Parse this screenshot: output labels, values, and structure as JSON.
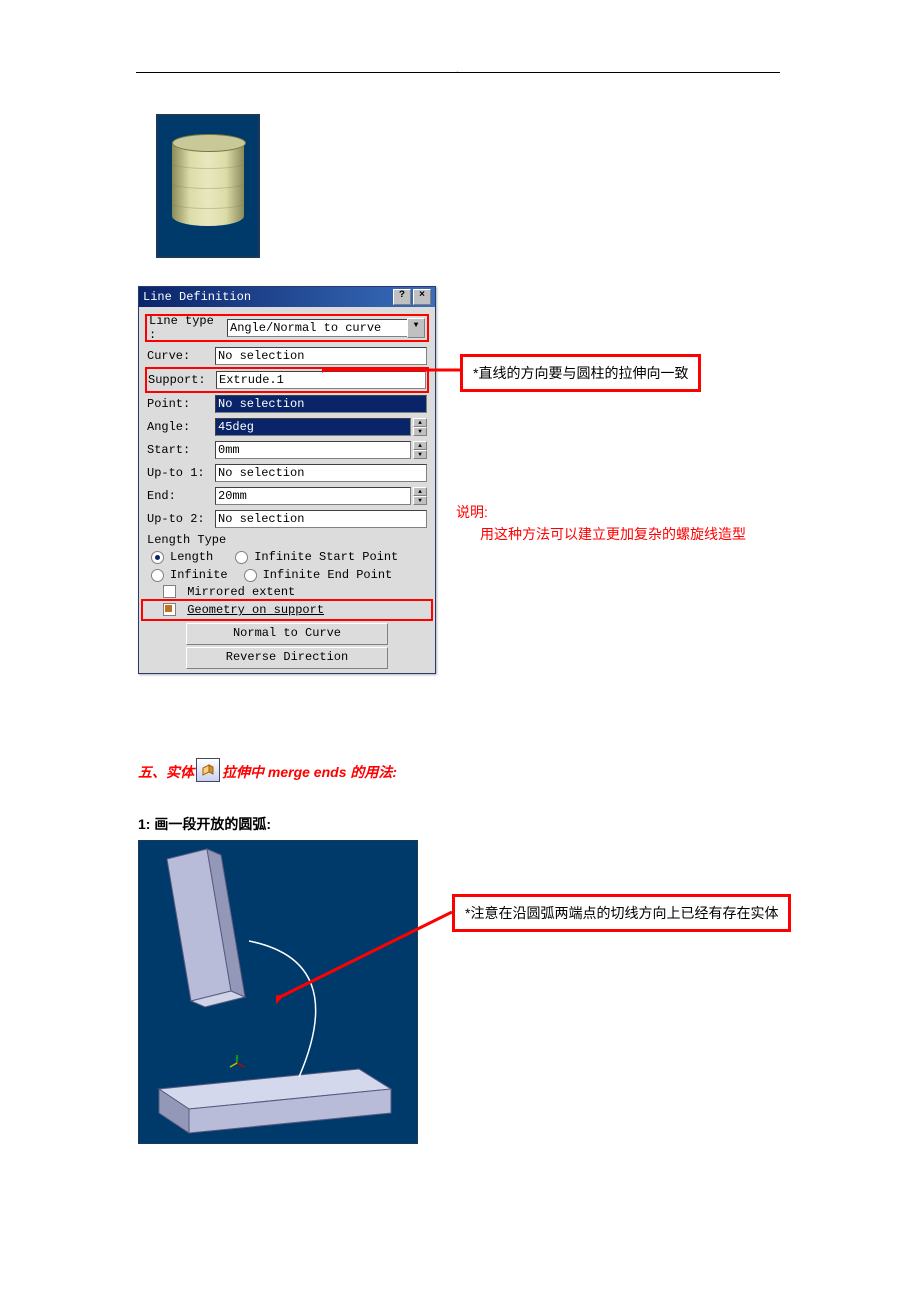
{
  "top_dot": ".",
  "dialog": {
    "title": "Line Definition",
    "help_btn": "?",
    "close_btn": "×",
    "line_type_label": "Line type :",
    "line_type_value": "Angle/Normal to curve",
    "curve_label": "Curve:",
    "curve_value": "No selection",
    "support_label": "Support:",
    "support_value": "Extrude.1",
    "point_label": "Point:",
    "point_value": "No selection",
    "angle_label": "Angle:",
    "angle_value": "45deg",
    "start_label": "Start:",
    "start_value": "0mm",
    "upto1_label": "Up-to 1:",
    "upto1_value": "No selection",
    "end_label": "End:",
    "end_value": "20mm",
    "upto2_label": "Up-to 2:",
    "upto2_value": "No selection",
    "length_type_label": "Length Type",
    "radio_length": "Length",
    "radio_inf_start": "Infinite Start Point",
    "radio_inf": "Infinite",
    "radio_inf_end": "Infinite End Point",
    "chk_mirrored": "Mirrored extent",
    "chk_geom_support": "Geometry on support",
    "btn_normal": "Normal to Curve",
    "btn_reverse": "Reverse Direction"
  },
  "anno1": "*直线的方向要与圆柱的拉伸向一致",
  "explain_title": "说明:",
  "explain_body": "用这种方法可以建立更加复杂的螺旋线造型",
  "section5_prefix": "五、实体",
  "section5_suffix": "拉伸中 merge ends 的用法:",
  "pad_icon_glyph": "§",
  "step1": "1: 画一段开放的圆弧:",
  "anno2": "*注意在沿圆弧两端点的切线方向上已经有存在实体"
}
